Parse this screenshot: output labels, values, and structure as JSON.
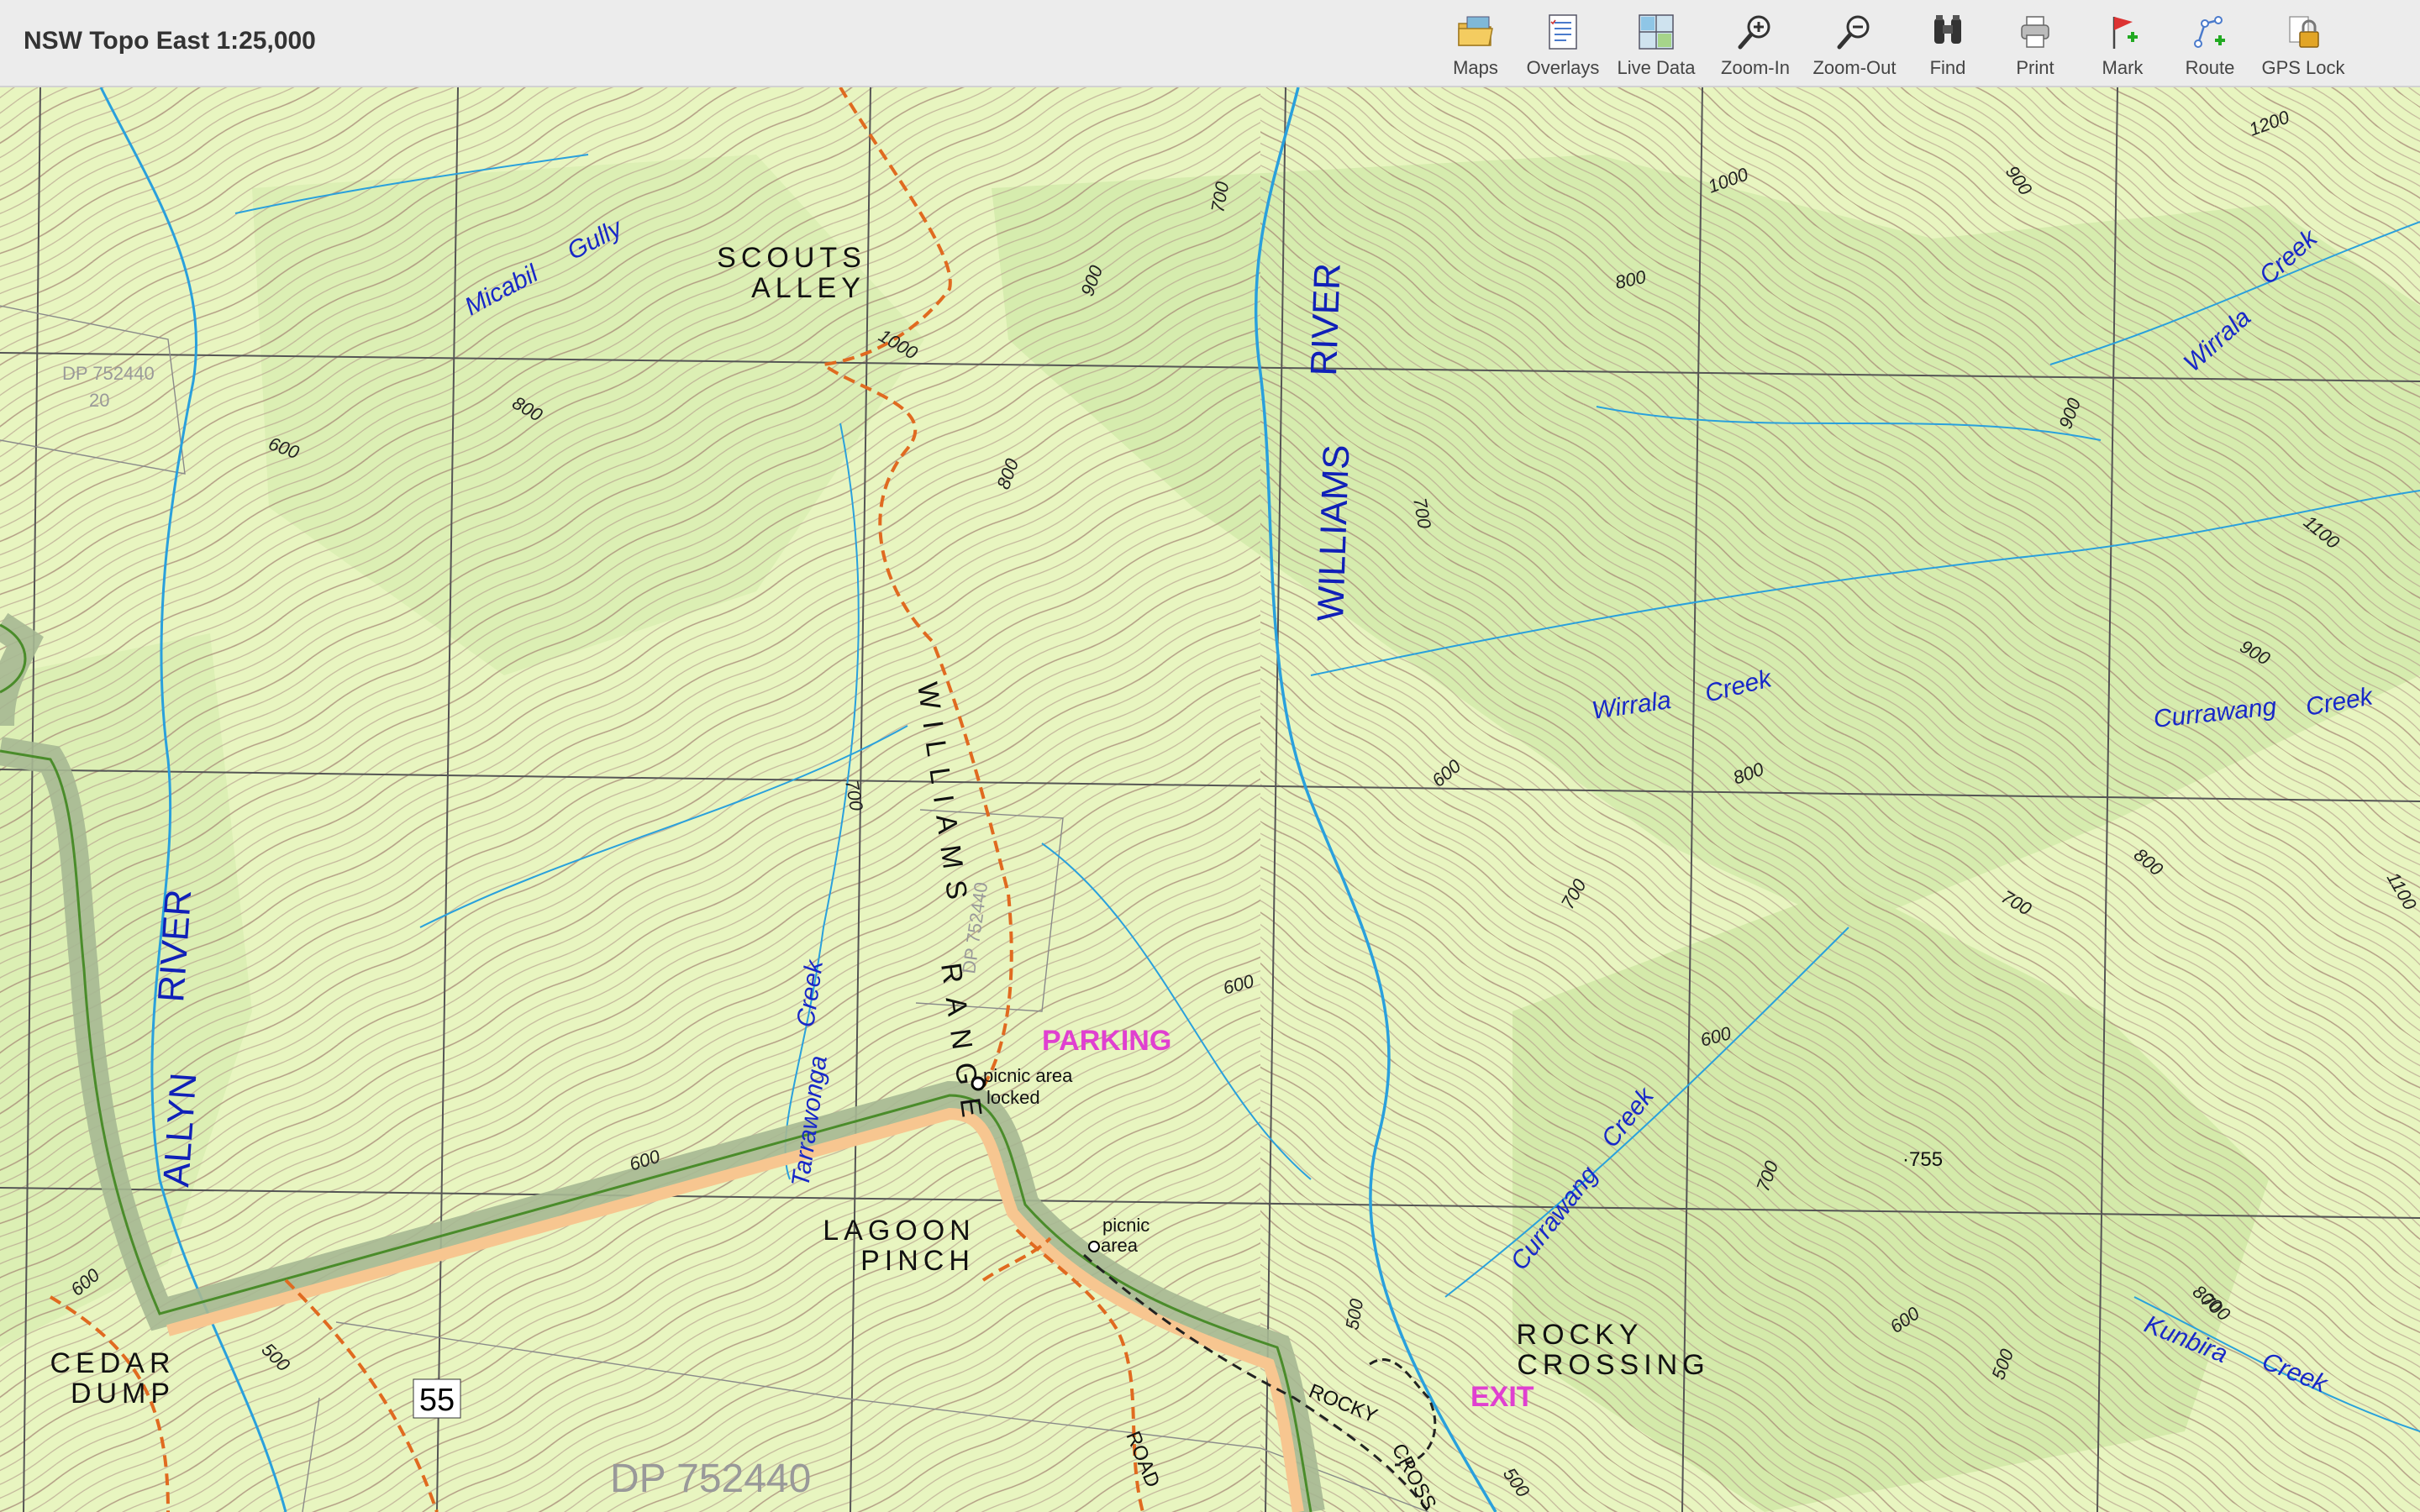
{
  "app": {
    "title": "NSW Topo East 1:25,000"
  },
  "toolbar": {
    "items": [
      {
        "label": "Maps",
        "icon": "folder-maps-icon"
      },
      {
        "label": "Overlays",
        "icon": "overlays-list-icon"
      },
      {
        "label": "Live Data",
        "icon": "live-data-grid-icon"
      },
      {
        "label": "Zoom-In",
        "icon": "zoom-in-icon"
      },
      {
        "label": "Zoom-Out",
        "icon": "zoom-out-icon"
      },
      {
        "label": "Find",
        "icon": "binoculars-icon"
      },
      {
        "label": "Print",
        "icon": "printer-icon"
      },
      {
        "label": "Mark",
        "icon": "flag-mark-icon"
      },
      {
        "label": "Route",
        "icon": "route-icon"
      },
      {
        "label": "GPS Lock",
        "icon": "gps-lock-icon"
      }
    ]
  },
  "map": {
    "colors": {
      "background": "#e8f5c0",
      "forest": "#d6ecae",
      "contour": "#b49c8c",
      "water": "#2aa0dc",
      "grid": "#555555",
      "boundary": "#4a8c2a",
      "track": "#e06a20",
      "annotation": "#e040d0"
    },
    "labels": {
      "scouts_alley_1": "SCOUTS",
      "scouts_alley_2": "ALLEY",
      "micabil": "Micabil",
      "gully": "Gully",
      "williams_river_1": "RIVER",
      "williams_river_2": "WILLIAMS",
      "williams_range": "WILLIAMS",
      "range": "RANGE",
      "allyn_river_1": "RIVER",
      "allyn_river_2": "ALLYN",
      "wirrala_creek_a": "Wirrala",
      "wirrala_creek_b": "Creek",
      "wirrala_ne": "Wirrala",
      "creek_ne": "Creek",
      "currawang_e": "Currawang",
      "creek_e": "Creek",
      "currawang_s": "Currawang",
      "creek_s": "Creek",
      "kunbira": "Kunbira",
      "creek_kunbira": "Creek",
      "tarrawonga": "Tarrawonga",
      "creek_tarrawonga": "Creek",
      "parking": "PARKING",
      "exit": "EXIT",
      "picnic_locked_1": "picnic area",
      "picnic_locked_2": "locked",
      "picnic_2_1": "picnic",
      "picnic_2_2": "area",
      "lagoon_1": "LAGOON",
      "lagoon_2": "PINCH",
      "cedar_1": "CEDAR",
      "cedar_2": "DUMP",
      "rocky_1": "ROCKY",
      "rocky_2": "CROSSING",
      "rocky_road": "ROCKY",
      "crossing_road": "CROSS",
      "road": "ROAD",
      "dp_large": "DP 752440",
      "dp_small": "DP 752440",
      "dp_small_num": "20",
      "dp_vertical": "DP 752440",
      "route_55": "55",
      "spot_755": "·755"
    },
    "contour_labels": [
      {
        "text": "700"
      },
      {
        "text": "900"
      },
      {
        "text": "1000"
      },
      {
        "text": "1200"
      },
      {
        "text": "900"
      },
      {
        "text": "800"
      },
      {
        "text": "1000"
      },
      {
        "text": "800"
      },
      {
        "text": "600"
      },
      {
        "text": "800"
      },
      {
        "text": "700"
      },
      {
        "text": "900"
      },
      {
        "text": "1100"
      },
      {
        "text": "900"
      },
      {
        "text": "600"
      },
      {
        "text": "800"
      },
      {
        "text": "700"
      },
      {
        "text": "700"
      },
      {
        "text": "600"
      },
      {
        "text": "800"
      },
      {
        "text": "1100"
      },
      {
        "text": "600"
      },
      {
        "text": "600"
      },
      {
        "text": "700"
      },
      {
        "text": "700"
      },
      {
        "text": "600"
      },
      {
        "text": "500"
      },
      {
        "text": "500"
      },
      {
        "text": "500"
      },
      {
        "text": "500"
      },
      {
        "text": "600"
      },
      {
        "text": "800"
      },
      {
        "text": "700"
      }
    ]
  }
}
